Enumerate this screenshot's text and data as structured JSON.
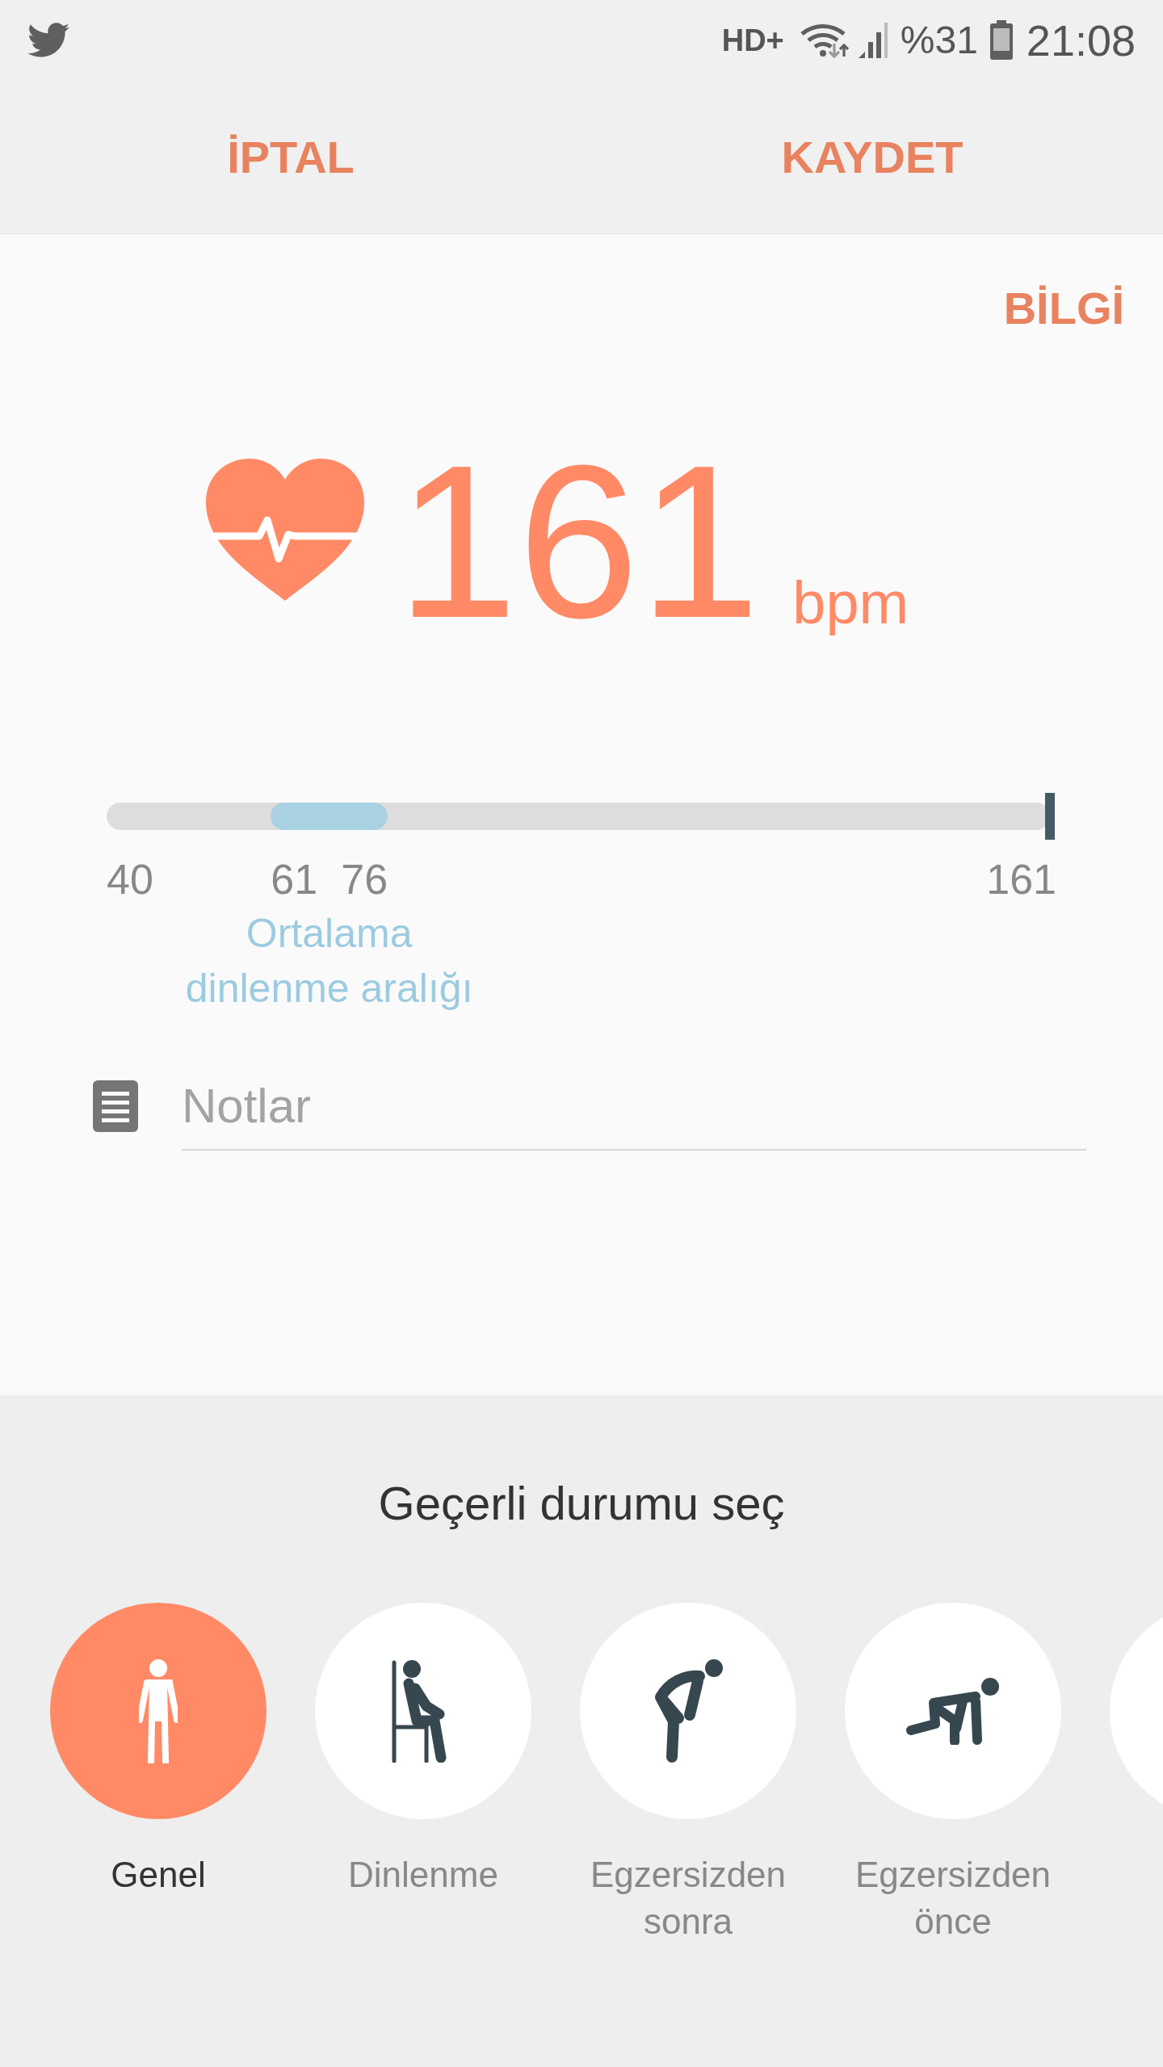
{
  "status_bar": {
    "network": "HD+",
    "battery": "%31",
    "time": "21:08"
  },
  "top_bar": {
    "cancel": "İPTAL",
    "save": "KAYDET"
  },
  "info_link": "BİLGİ",
  "reading": {
    "value": "161",
    "unit": "bpm"
  },
  "range": {
    "min_label": "40",
    "max_label": "161",
    "band_from": {
      "label": "61"
    },
    "band_to": {
      "label": "76"
    },
    "band_caption": "Ortalama\ndinlenme aralığı"
  },
  "notes": {
    "placeholder": "Notlar"
  },
  "status_picker": {
    "title": "Geçerli durumu seç",
    "items": [
      {
        "kind": "standing",
        "label": "Genel",
        "selected": true
      },
      {
        "kind": "sitting",
        "label": "Dinlenme",
        "selected": false
      },
      {
        "kind": "bending",
        "label": "Egzersizden\nsonra",
        "selected": false
      },
      {
        "kind": "crouching",
        "label": "Egzersizden\nönce",
        "selected": false
      },
      {
        "kind": "unknown",
        "selected": false
      }
    ]
  }
}
